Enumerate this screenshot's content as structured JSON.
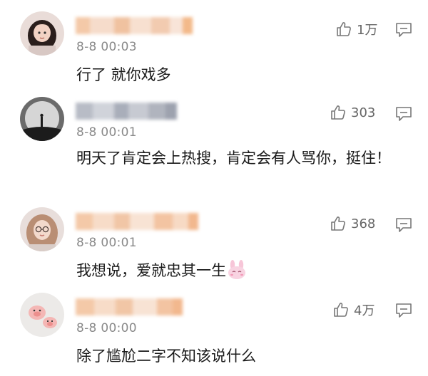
{
  "comments": [
    {
      "username": "",
      "timestamp": "8-8 00:03",
      "text": "行了 就你戏多",
      "likes": "1万",
      "avatar_icon": "girl-portrait-avatar",
      "like_icon": "thumbs-up-icon",
      "reply_icon": "comment-bubble-icon"
    },
    {
      "username": "",
      "timestamp": "8-8 00:01",
      "text": "明天了肯定会上热搜，肯定会有人骂你，挺住！",
      "likes": "303",
      "avatar_icon": "moon-figure-avatar",
      "like_icon": "thumbs-up-icon",
      "reply_icon": "comment-bubble-icon"
    },
    {
      "username": "",
      "timestamp": "8-8 00:01",
      "text": "我想说，爱就忠其一生",
      "likes": "368",
      "emoji": "rabbit-face-emoji",
      "avatar_icon": "glasses-girl-avatar",
      "like_icon": "thumbs-up-icon",
      "reply_icon": "comment-bubble-icon"
    },
    {
      "username": "",
      "timestamp": "8-8 00:00",
      "text": "除了尴尬二字不知该说什么",
      "likes": "4万",
      "avatar_icon": "pig-toys-avatar",
      "like_icon": "thumbs-up-icon",
      "reply_icon": "comment-bubble-icon"
    }
  ],
  "colors": {
    "timestamp": "#8a8a8a",
    "text": "#1a1a1a",
    "icon": "#777777",
    "background": "#ffffff"
  }
}
